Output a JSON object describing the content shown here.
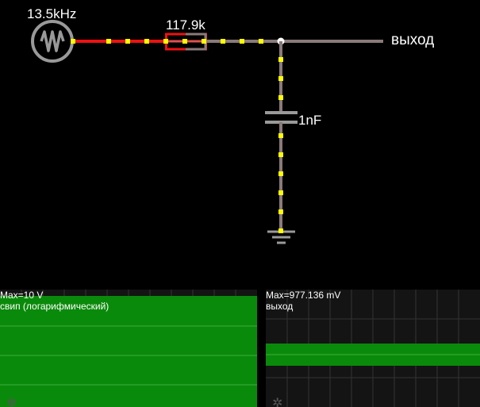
{
  "circuit": {
    "source_label": "13.5kHz",
    "resistor_label": "117.9k",
    "capacitor_label": "1nF",
    "output_label": "выход"
  },
  "scopes": [
    {
      "max_label": "Max=10 V",
      "title": "свип (логарифмический)",
      "trace_color": "#0a8a0a"
    },
    {
      "max_label": "Max=977.136 mV",
      "title": "выход",
      "trace_color": "#0a8a0a"
    }
  ],
  "colors": {
    "background": "#000000",
    "wire": "#8a7a7a",
    "current_wire": "#ee1111",
    "current_dots": "#ffff00",
    "component": "#999999",
    "scope_bg": "#141414",
    "grid": "#333333"
  }
}
